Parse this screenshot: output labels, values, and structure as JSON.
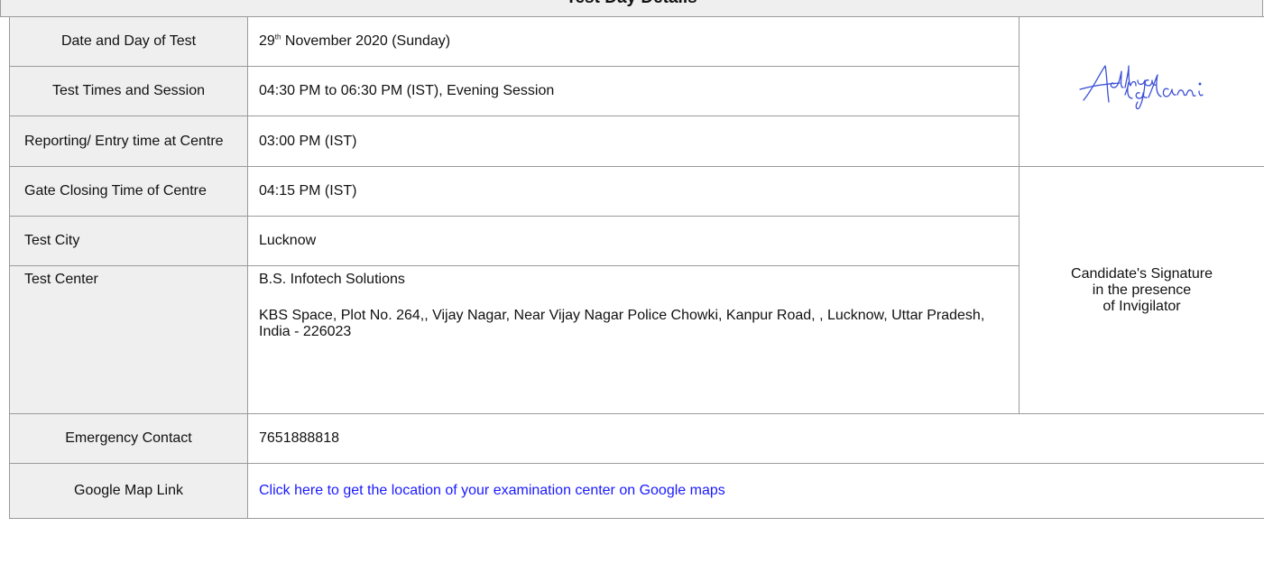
{
  "section_title": "Test Day Details",
  "rows": [
    {
      "label": "Date and Day of Test",
      "day": "29",
      "day_suffix": "th",
      "value_rest": " November 2020 (Sunday)"
    },
    {
      "label": "Test Times and Session",
      "value": "04:30 PM to 06:30 PM (IST), Evening Session"
    },
    {
      "label": "Reporting/ Entry time at Centre",
      "value": "03:00 PM (IST)"
    },
    {
      "label": "Gate Closing Time of Centre",
      "value": "04:15 PM (IST)"
    },
    {
      "label": "Test City",
      "value": "Lucknow"
    },
    {
      "label": "Test Center",
      "center_name": "B.S. Infotech Solutions",
      "center_address": "KBS Space, Plot No. 264,, Vijay Nagar, Near Vijay Nagar Police Chowki, Kanpur Road, , Lucknow, Uttar Pradesh, India - 226023"
    },
    {
      "label": "Emergency Contact",
      "value": "7651888818"
    },
    {
      "label": "Google Map Link",
      "link_text": "Click here to get the location of your examination center on Google maps"
    }
  ],
  "signature": {
    "handwritten": "Adhya Lalani",
    "caption_line1": "Candidate's Signature",
    "caption_line2": "in the presence",
    "caption_line3": "of Invigilator",
    "ink_color": "#3b4fd8"
  },
  "colors": {
    "label_bg": "#efefef",
    "border": "#9a9a9a",
    "link": "#1a1aff"
  }
}
